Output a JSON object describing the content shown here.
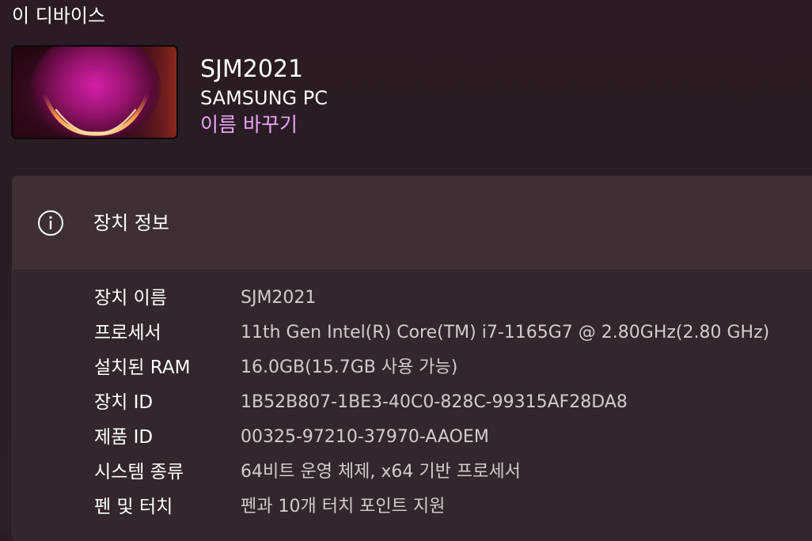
{
  "section": {
    "title": "이 디바이스"
  },
  "device": {
    "name": "SJM2021",
    "model": "SAMSUNG PC",
    "rename_link": "이름 바꾸기",
    "thumbnail_icon": "windows-bloom-wallpaper"
  },
  "card": {
    "icon": "info-icon",
    "title": "장치 정보",
    "specs": [
      {
        "label": "장치 이름",
        "value": "SJM2021"
      },
      {
        "label": "프로세서",
        "value": "11th Gen Intel(R) Core(TM) i7-1165G7 @ 2.80GHz(2.80 GHz)"
      },
      {
        "label": "설치된 RAM",
        "value": "16.0GB(15.7GB 사용 가능)"
      },
      {
        "label": "장치 ID",
        "value": "1B52B807-1BE3-40C0-828C-99315AF28DA8"
      },
      {
        "label": "제품 ID",
        "value": "00325-97210-37970-AAOEM"
      },
      {
        "label": "시스템 종류",
        "value": "64비트 운영 체제, x64 기반 프로세서"
      },
      {
        "label": "펜 및 터치",
        "value": "펜과 10개 터치 포인트 지원"
      }
    ]
  },
  "colors": {
    "background": "#2b1b24",
    "card": "#3a2b33",
    "link": "#e8a6f2",
    "secondary_text": "#d2cbcf"
  }
}
